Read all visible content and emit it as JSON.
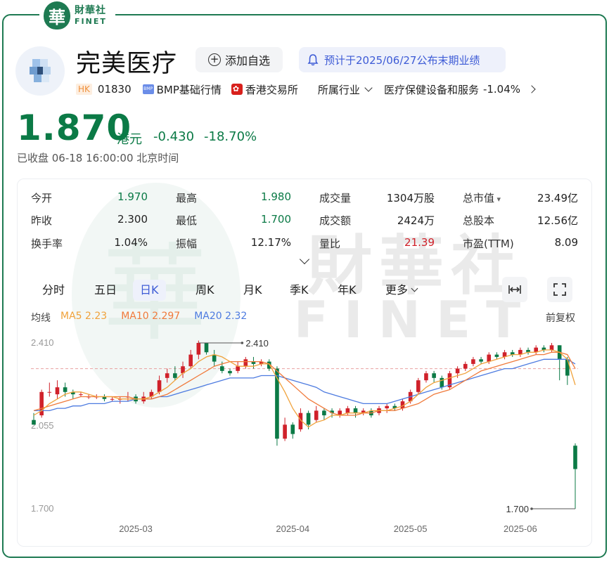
{
  "brand": {
    "mark": "華",
    "name_cn": "財華社",
    "name_en": "FINET"
  },
  "header": {
    "stock_name": "完美医疗",
    "watch_button": "添加自选",
    "notice": "预计于2025/06/27公布末期业绩",
    "market_tag": "HK",
    "code": "01830",
    "bmp_label": "BMP基础行情",
    "exchange": "香港交易所",
    "industry_dropdown": "所属行业",
    "industry": "医疗保健设备和服务",
    "industry_change": "-1.04%"
  },
  "quote": {
    "price": "1.870",
    "unit": "港元",
    "change": "-0.430",
    "change_pct": "-18.70%",
    "status": "已收盘  06-18 16:00:00 北京时间"
  },
  "stats": [
    [
      {
        "label": "今开",
        "value": "1.970",
        "tone": "dn"
      },
      {
        "label": "最高",
        "value": "1.980",
        "tone": "dn"
      },
      {
        "label": "成交量",
        "value": "1304万股",
        "tone": ""
      },
      {
        "label": "总市值",
        "value": "23.49亿",
        "tone": ""
      }
    ],
    [
      {
        "label": "昨收",
        "value": "2.300",
        "tone": ""
      },
      {
        "label": "最低",
        "value": "1.700",
        "tone": "dn"
      },
      {
        "label": "成交额",
        "value": "2424万",
        "tone": ""
      },
      {
        "label": "总股本",
        "value": "12.56亿",
        "tone": ""
      }
    ],
    [
      {
        "label": "换手率",
        "value": "1.04%",
        "tone": ""
      },
      {
        "label": "振幅",
        "value": "12.17%",
        "tone": ""
      },
      {
        "label": "量比",
        "value": "21.39",
        "tone": "up"
      },
      {
        "label": "市盈(TTM)",
        "value": "8.09",
        "tone": ""
      }
    ]
  ],
  "tabs": [
    "分时",
    "五日",
    "日K",
    "周K",
    "月K",
    "季K",
    "年K",
    "更多"
  ],
  "active_tab": "日K",
  "ma": {
    "label": "均线",
    "ma5": "MA5 2.23",
    "ma10": "MA10 2.297",
    "ma20": "MA20 2.32",
    "adjust": "前复权"
  },
  "colors": {
    "up": "#d0212a",
    "down": "#0b7a46",
    "ma5": "#f0a23b",
    "ma10": "#f07a3b",
    "ma20": "#4d7be0",
    "accent": "#3d5bd6"
  },
  "chart_data": {
    "type": "candlestick",
    "y_ticks": [
      "2.410",
      "2.055",
      "1.700"
    ],
    "ylim": [
      1.7,
      2.41
    ],
    "x_ticks": [
      "2025-03",
      "2025-04",
      "2025-05",
      "2025-06"
    ],
    "annotations": {
      "high": "2.410",
      "low": "1.700"
    },
    "prev_close": 2.3,
    "candles": [
      [
        2.08,
        2.06,
        2.11,
        2.06
      ],
      [
        2.1,
        2.2,
        2.21,
        2.09
      ],
      [
        2.2,
        2.2,
        2.24,
        2.18
      ],
      [
        2.19,
        2.22,
        2.25,
        2.17
      ],
      [
        2.22,
        2.2,
        2.24,
        2.18
      ],
      [
        2.2,
        2.19,
        2.21,
        2.17
      ],
      [
        2.19,
        2.19,
        2.2,
        2.18
      ],
      [
        2.18,
        2.18,
        2.19,
        2.17
      ],
      [
        2.18,
        2.18,
        2.19,
        2.17
      ],
      [
        2.18,
        2.17,
        2.19,
        2.16
      ],
      [
        2.17,
        2.17,
        2.18,
        2.16
      ],
      [
        2.17,
        2.17,
        2.18,
        2.15
      ],
      [
        2.18,
        2.18,
        2.2,
        2.16
      ],
      [
        2.18,
        2.16,
        2.19,
        2.15
      ],
      [
        2.16,
        2.18,
        2.2,
        2.15
      ],
      [
        2.18,
        2.2,
        2.21,
        2.17
      ],
      [
        2.2,
        2.25,
        2.27,
        2.19
      ],
      [
        2.26,
        2.28,
        2.3,
        2.24
      ],
      [
        2.28,
        2.26,
        2.31,
        2.25
      ],
      [
        2.28,
        2.31,
        2.33,
        2.26
      ],
      [
        2.31,
        2.36,
        2.38,
        2.3
      ],
      [
        2.36,
        2.41,
        2.42,
        2.34
      ],
      [
        2.41,
        2.37,
        2.41,
        2.36
      ],
      [
        2.36,
        2.33,
        2.38,
        2.31
      ],
      [
        2.31,
        2.29,
        2.33,
        2.28
      ],
      [
        2.29,
        2.28,
        2.3,
        2.27
      ],
      [
        2.29,
        2.31,
        2.33,
        2.28
      ],
      [
        2.31,
        2.34,
        2.35,
        2.3
      ],
      [
        2.33,
        2.32,
        2.35,
        2.3
      ],
      [
        2.32,
        2.33,
        2.34,
        2.31
      ],
      [
        2.33,
        2.3,
        2.34,
        2.29
      ],
      [
        2.3,
        2.0,
        2.31,
        1.97
      ],
      [
        2.0,
        2.06,
        2.09,
        1.99
      ],
      [
        2.06,
        2.02,
        2.07,
        2.0
      ],
      [
        2.04,
        2.11,
        2.13,
        2.03
      ],
      [
        2.11,
        2.06,
        2.12,
        2.04
      ],
      [
        2.08,
        2.12,
        2.14,
        2.07
      ],
      [
        2.12,
        2.1,
        2.13,
        2.08
      ],
      [
        2.12,
        2.11,
        2.13,
        2.09
      ],
      [
        2.1,
        2.12,
        2.13,
        2.09
      ],
      [
        2.11,
        2.13,
        2.14,
        2.1
      ],
      [
        2.13,
        2.11,
        2.14,
        2.09
      ],
      [
        2.11,
        2.12,
        2.13,
        2.1
      ],
      [
        2.12,
        2.1,
        2.13,
        2.09
      ],
      [
        2.11,
        2.13,
        2.14,
        2.1
      ],
      [
        2.13,
        2.14,
        2.15,
        2.11
      ],
      [
        2.14,
        2.13,
        2.15,
        2.12
      ],
      [
        2.13,
        2.16,
        2.17,
        2.12
      ],
      [
        2.16,
        2.2,
        2.21,
        2.15
      ],
      [
        2.2,
        2.25,
        2.26,
        2.19
      ],
      [
        2.25,
        2.28,
        2.29,
        2.24
      ],
      [
        2.28,
        2.26,
        2.29,
        2.24
      ],
      [
        2.26,
        2.22,
        2.27,
        2.21
      ],
      [
        2.22,
        2.28,
        2.29,
        2.21
      ],
      [
        2.28,
        2.3,
        2.31,
        2.26
      ],
      [
        2.3,
        2.32,
        2.33,
        2.29
      ],
      [
        2.32,
        2.34,
        2.35,
        2.31
      ],
      [
        2.34,
        2.33,
        2.35,
        2.32
      ],
      [
        2.33,
        2.36,
        2.37,
        2.32
      ],
      [
        2.36,
        2.35,
        2.37,
        2.34
      ],
      [
        2.35,
        2.37,
        2.38,
        2.34
      ],
      [
        2.37,
        2.36,
        2.38,
        2.35
      ],
      [
        2.36,
        2.38,
        2.39,
        2.35
      ],
      [
        2.38,
        2.37,
        2.39,
        2.36
      ],
      [
        2.37,
        2.39,
        2.4,
        2.36
      ],
      [
        2.39,
        2.38,
        2.4,
        2.37
      ],
      [
        2.38,
        2.4,
        2.41,
        2.37
      ],
      [
        2.4,
        2.34,
        2.4,
        2.25
      ],
      [
        2.34,
        2.27,
        2.35,
        2.23
      ],
      [
        1.97,
        1.87,
        1.98,
        1.7
      ]
    ],
    "ma5_series": [
      2.1,
      2.12,
      2.15,
      2.17,
      2.19,
      2.2,
      2.2,
      2.19,
      2.18,
      2.18,
      2.18,
      2.17,
      2.17,
      2.17,
      2.17,
      2.18,
      2.2,
      2.22,
      2.25,
      2.28,
      2.3,
      2.33,
      2.35,
      2.36,
      2.35,
      2.33,
      2.31,
      2.31,
      2.31,
      2.32,
      2.32,
      2.26,
      2.2,
      2.13,
      2.08,
      2.05,
      2.07,
      2.08,
      2.1,
      2.1,
      2.11,
      2.11,
      2.11,
      2.12,
      2.12,
      2.12,
      2.13,
      2.14,
      2.16,
      2.19,
      2.22,
      2.24,
      2.25,
      2.26,
      2.27,
      2.28,
      2.3,
      2.32,
      2.33,
      2.34,
      2.35,
      2.36,
      2.36,
      2.37,
      2.37,
      2.38,
      2.38,
      2.37,
      2.34,
      2.23
    ],
    "ma10_series": [
      2.12,
      2.13,
      2.14,
      2.15,
      2.16,
      2.17,
      2.18,
      2.18,
      2.18,
      2.18,
      2.18,
      2.18,
      2.18,
      2.17,
      2.17,
      2.17,
      2.18,
      2.19,
      2.21,
      2.23,
      2.25,
      2.27,
      2.29,
      2.31,
      2.32,
      2.33,
      2.33,
      2.33,
      2.33,
      2.33,
      2.32,
      2.29,
      2.26,
      2.23,
      2.2,
      2.17,
      2.15,
      2.13,
      2.11,
      2.1,
      2.1,
      2.1,
      2.11,
      2.11,
      2.12,
      2.12,
      2.12,
      2.13,
      2.14,
      2.15,
      2.17,
      2.19,
      2.2,
      2.21,
      2.23,
      2.25,
      2.27,
      2.29,
      2.3,
      2.31,
      2.32,
      2.33,
      2.34,
      2.35,
      2.36,
      2.36,
      2.37,
      2.37,
      2.36,
      2.3
    ],
    "ma20_series": [
      2.12,
      2.12,
      2.12,
      2.13,
      2.13,
      2.14,
      2.14,
      2.15,
      2.15,
      2.15,
      2.16,
      2.16,
      2.16,
      2.17,
      2.17,
      2.17,
      2.18,
      2.18,
      2.19,
      2.2,
      2.21,
      2.22,
      2.23,
      2.24,
      2.25,
      2.26,
      2.26,
      2.26,
      2.26,
      2.27,
      2.27,
      2.27,
      2.26,
      2.25,
      2.24,
      2.23,
      2.22,
      2.2,
      2.19,
      2.18,
      2.17,
      2.16,
      2.15,
      2.15,
      2.15,
      2.15,
      2.16,
      2.17,
      2.18,
      2.19,
      2.2,
      2.21,
      2.22,
      2.23,
      2.24,
      2.25,
      2.26,
      2.27,
      2.28,
      2.29,
      2.3,
      2.3,
      2.31,
      2.32,
      2.33,
      2.34,
      2.34,
      2.34,
      2.34,
      2.32
    ]
  }
}
